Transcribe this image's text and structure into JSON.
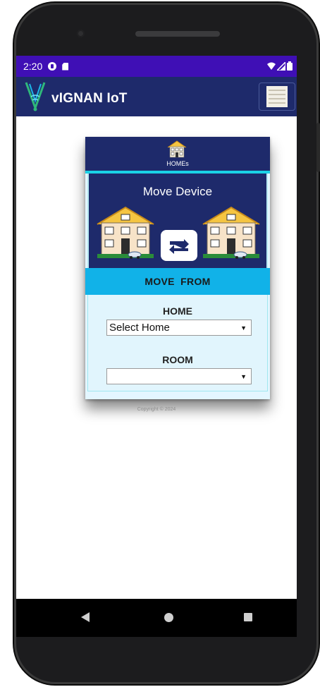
{
  "status_bar": {
    "time": "2:20"
  },
  "app": {
    "title": "vIGNAN IoT"
  },
  "nav": {
    "homes_label": "HOMEs"
  },
  "move_device": {
    "title": "Move Device",
    "section_label": "MOVE  FROM",
    "home_label": "HOME",
    "home_select_value": "Select Home",
    "room_label": "ROOM",
    "room_select_value": ""
  },
  "footer": {
    "copyright": "Copyright © 2024"
  },
  "colors": {
    "status_bar": "#3f0fb5",
    "app_bar": "#1e2a6b",
    "accent_cyan": "#11b2e8",
    "form_bg": "#e1f5fd"
  },
  "icons": [
    "signal-icon",
    "vignan-logo-icon",
    "hamburger-menu-icon",
    "home-building-icon",
    "house-illustration",
    "swap-arrows-icon",
    "back-icon",
    "home-circle-icon",
    "recents-icon"
  ]
}
